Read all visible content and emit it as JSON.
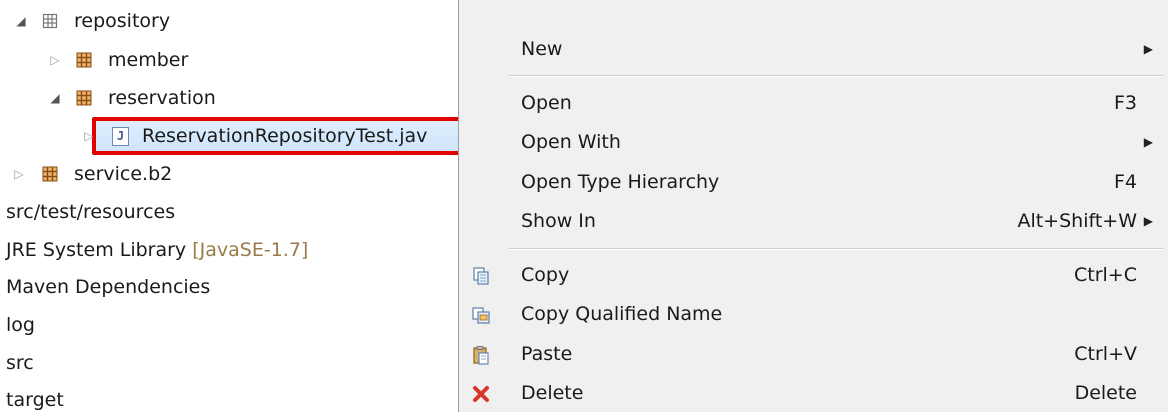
{
  "tree": {
    "items": [
      {
        "label": "repository"
      },
      {
        "label": "member"
      },
      {
        "label": "reservation"
      },
      {
        "label": "ReservationRepositoryTest.jav"
      },
      {
        "label": "service.b2"
      },
      {
        "label": "src/test/resources"
      },
      {
        "label": "JRE System Library",
        "suffix": "[JavaSE-1.7]"
      },
      {
        "label": "Maven Dependencies"
      },
      {
        "label": "log"
      },
      {
        "label": "src"
      },
      {
        "label": "target"
      }
    ]
  },
  "context_menu": {
    "items": [
      {
        "label": "New",
        "shortcut": "",
        "submenu": true
      },
      {
        "label": "Open",
        "shortcut": "F3"
      },
      {
        "label": "Open With",
        "shortcut": "",
        "submenu": true
      },
      {
        "label": "Open Type Hierarchy",
        "shortcut": "F4"
      },
      {
        "label": "Show In",
        "shortcut": "Alt+Shift+W",
        "submenu": true
      },
      {
        "label": "Copy",
        "shortcut": "Ctrl+C",
        "icon": "copy-icon"
      },
      {
        "label": "Copy Qualified Name",
        "shortcut": "",
        "icon": "copy-qualified-name-icon"
      },
      {
        "label": "Paste",
        "shortcut": "Ctrl+V",
        "icon": "paste-icon"
      },
      {
        "label": "Delete",
        "shortcut": "Delete",
        "icon": "delete-icon"
      }
    ]
  },
  "colors": {
    "selection_border": "#e00000",
    "package_icon": "#b5651d",
    "menu_background": "#f0f0f0",
    "library_suffix": "#9a7a4a"
  }
}
